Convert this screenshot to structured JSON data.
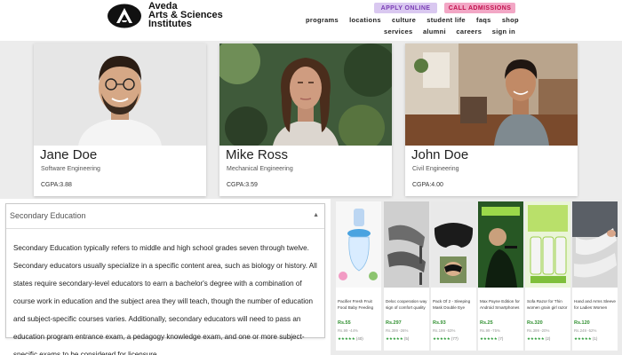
{
  "brand": {
    "line1": "Aveda",
    "line2": "Arts & Sciences",
    "line3": "Institutes"
  },
  "cta": {
    "apply": "APPLY ONLINE",
    "call": "CALL ADMISSIONS"
  },
  "nav": {
    "row1": [
      "programs",
      "locations",
      "culture",
      "student life",
      "faqs",
      "shop"
    ],
    "row2": [
      "services",
      "alumni",
      "careers",
      "sign in"
    ]
  },
  "students": [
    {
      "name": "Jane Doe",
      "dept": "Software Engineering",
      "gpa": "CGPA:3.88"
    },
    {
      "name": "Mike Ross",
      "dept": "Mechanical Engineering",
      "gpa": "CGPA:3.59"
    },
    {
      "name": "John Doe",
      "dept": "Civil Engineering",
      "gpa": "CGPA:4.00"
    }
  ],
  "accordion": {
    "title": "Secondary Education",
    "caret": "▲",
    "body": "Secondary Education typically refers to middle and high school grades seven through twelve. Secondary educators usually specialize in a specific content area, such as biology or history. All states require secondary-level educators to earn a bachelor's degree with a combination of course work in education and the subject area they will teach, though the number of education and subject-specific courses varies. Additionally, secondary educators will need to pass an education program entrance exam, a pedagogy knowledge exam, and one or more subject-specific exams to be considered for licensure."
  },
  "products": [
    {
      "title": "Pacifier Fresh Fruit Food Baby Feeding Safe Fruit",
      "price": "Rs.55",
      "old": "Rs.99 -44%",
      "rating": "★★★★★",
      "count": "(40)",
      "icon": "pacifier-product-image"
    },
    {
      "title": "Deloc cooperation way sign of comfort quality so",
      "price": "Rs.297",
      "old": "Rs.399 -26%",
      "rating": "★★★★★",
      "count": "(5)",
      "icon": "heels-product-image"
    },
    {
      "title": "Pack Of 2 - Sleeping Mask Double Eye Shade Cover",
      "price": "Rs.93",
      "old": "Rs.199 -53%",
      "rating": "★★★★★",
      "count": "(77)",
      "icon": "sleep-mask-product-image"
    },
    {
      "title": "Max Payne Edition for Android Smartphones",
      "price": "Rs.25",
      "old": "Rs.99 -75%",
      "rating": "★★★★★",
      "count": "(7)",
      "icon": "game-product-image"
    },
    {
      "title": "Sofa Razor for Thin women grain girl razor pad",
      "price": "Rs.320",
      "old": "Rs.399 -20%",
      "rating": "★★★★★",
      "count": "(2)",
      "icon": "razor-product-image"
    },
    {
      "title": "Hand and Arms Sleeve for Ladies Women Washable",
      "price": "Rs.120",
      "old": "Rs.249 -52%",
      "rating": "★★★★★",
      "count": "(1)",
      "icon": "arm-sleeves-product-image"
    }
  ],
  "colors": {
    "apply_bg": "#d9c8f0",
    "call_bg": "#f2a7c5",
    "price_green": "#2f8f2f"
  }
}
